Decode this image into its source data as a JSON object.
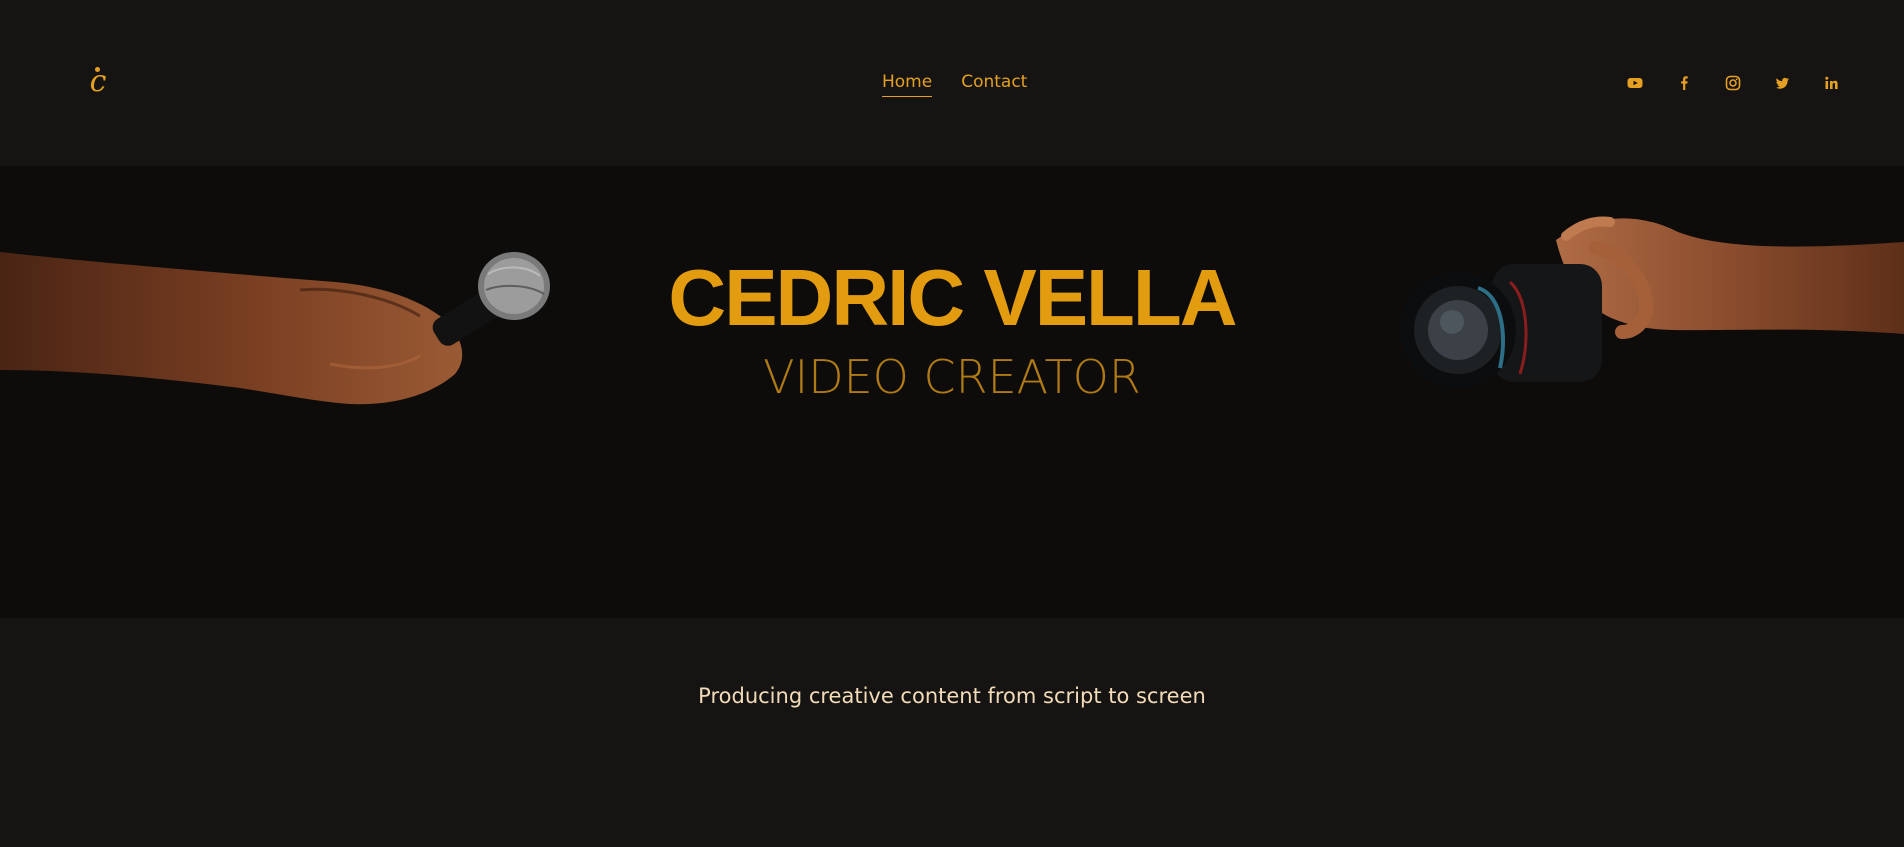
{
  "brand": {
    "logo_text": "c"
  },
  "nav": {
    "items": [
      {
        "label": "Home",
        "active": true
      },
      {
        "label": "Contact",
        "active": false
      }
    ]
  },
  "social": {
    "icons": [
      "youtube-icon",
      "facebook-icon",
      "instagram-icon",
      "twitter-icon",
      "linkedin-icon"
    ]
  },
  "hero": {
    "title": "CEDRIC VELLA",
    "subtitle": "VIDEO CREATOR"
  },
  "tagline": "Producing creative content from script to screen",
  "colors": {
    "accent": "#e5a021",
    "background": "#151413",
    "hero_background": "#0d0c0b",
    "tagline_text": "#f3dbb8"
  }
}
